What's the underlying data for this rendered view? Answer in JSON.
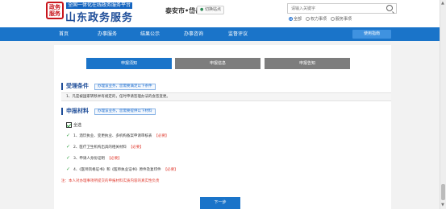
{
  "header": {
    "logo_seal": "政务服务",
    "logo_subtitle": "全国一体化在线政务服务平台",
    "logo_title": "山东政务服务",
    "region": "泰安市•岱岳区",
    "switch_label": "切换站点",
    "search_placeholder": "请输入关键字",
    "radios": [
      {
        "label": "全部",
        "checked": true
      },
      {
        "label": "权力事项",
        "checked": false
      },
      {
        "label": "服务事项",
        "checked": false
      }
    ]
  },
  "nav": {
    "items": [
      "首页",
      "办事服务",
      "结果公示",
      "办事咨询",
      "监督评议"
    ],
    "guide": "使用指南"
  },
  "steps": [
    "申报须知",
    "申报信息",
    "申报告知"
  ],
  "conditions": {
    "title": "受理条件",
    "tag": "办理该业务，您需要满足以下条件",
    "row": "1、凡是被国家转移并有规定的，任时申请签理办法的会签变更。"
  },
  "materials": {
    "title": "申报材料",
    "tag": "办理该业务，您需要提供以下材料",
    "check_all": "全选",
    "required_text": "【必要】",
    "items": [
      {
        "text": "1、酒饮执业、变更执业、多机构备案申请审核表"
      },
      {
        "text": "2、医疗卫生机构出具的相关材料"
      },
      {
        "text": "3、申请人身份证明"
      },
      {
        "text": "4、《医师资格证书》和《医师执业证书》原件及复印件"
      }
    ]
  },
  "note": "注：本人对办理事项所提交的申报材料实质内容的真实性负责",
  "next_button": "下一步",
  "colors": {
    "brand_blue": "#1a74c9",
    "accent_red": "#e03a2e",
    "check_green": "#2a9d3a"
  }
}
